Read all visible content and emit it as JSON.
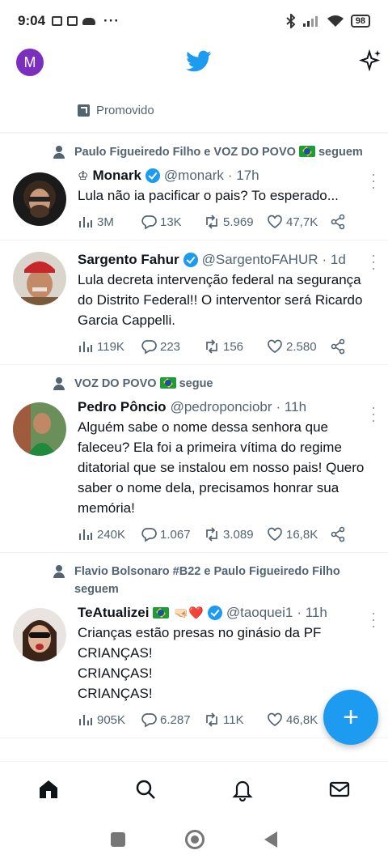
{
  "status_bar": {
    "time": "9:04",
    "dots": "···",
    "battery": "98"
  },
  "topbar": {
    "account_initial": "M"
  },
  "promoted_label": "Promovido",
  "tweets": [
    {
      "social": "Paulo Figueiredo Filho e VOZ DO POVO",
      "social_suffix": "seguem",
      "name": "Monark",
      "prefix_emoji": "♔",
      "handle": "@monark",
      "time": "· 17h",
      "text": "Lula não ia pacificar o pais? To esperado...",
      "views": "3M",
      "replies": "13K",
      "retweets": "5.969",
      "likes": "47,7K"
    },
    {
      "name": "Sargento Fahur",
      "handle": "@SargentoFAHUR",
      "time": "· 1d",
      "text": "Lula decreta intervenção federal na segurança do Distrito Federal!! O interventor será Ricardo Garcia Cappelli.",
      "views": "119K",
      "replies": "223",
      "retweets": "156",
      "likes": "2.580"
    },
    {
      "social": "VOZ DO POVO",
      "social_suffix": "segue",
      "name": "Pedro Pôncio",
      "handle": "@pedroponciobr",
      "time": "· 11h",
      "text": "Alguém sabe o nome dessa senhora que faleceu? Ela foi a primeira vítima do regime ditatorial que se instalou em nosso pais! Quero saber o nome dela, precisamos honrar sua memória!",
      "views": "240K",
      "replies": "1.067",
      "retweets": "3.089",
      "likes": "16,8K"
    },
    {
      "social": "Flavio Bolsonaro #B22 e Paulo Figueiredo Filho seguem",
      "name": "TeAtualizei",
      "name_emojis": "🤜🏻❤️",
      "handle": "@taoquei1",
      "time": "· 11h",
      "text": "Crianças estão presas no ginásio da PF\nCRIANÇAS!\nCRIANÇAS!\nCRIANÇAS!",
      "views": "905K",
      "replies": "6.287",
      "retweets": "11K",
      "likes": "46,8K"
    }
  ],
  "fab_label": "+",
  "colors": {
    "accent": "#1d9bf0",
    "muted": "#536471",
    "text": "#0f1419"
  }
}
